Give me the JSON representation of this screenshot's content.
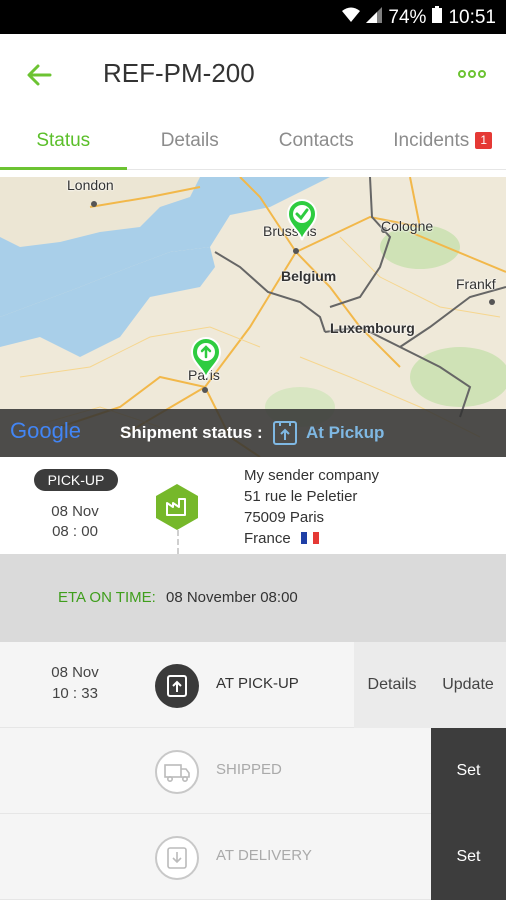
{
  "status_bar": {
    "battery": "74%",
    "time": "10:51"
  },
  "header": {
    "title": "REF-PM-200",
    "back_icon": "arrow-left-icon",
    "menu_icon": "more-dots-icon",
    "accent": "#6cc332"
  },
  "tabs": [
    {
      "label": "Status",
      "active": true
    },
    {
      "label": "Details",
      "active": false
    },
    {
      "label": "Contacts",
      "active": false
    },
    {
      "label": "Incidents",
      "active": false,
      "badge": "1"
    }
  ],
  "map": {
    "cities": [
      "London",
      "Brussels",
      "Belgium",
      "Cologne",
      "Frankf",
      "Luxembourg",
      "Paris"
    ],
    "google_logo": "Google",
    "shipment_status_label": "Shipment status :",
    "shipment_status_value": "At Pickup"
  },
  "pickup": {
    "badge": "PICK-UP",
    "date": "08 Nov",
    "time": "08 : 00",
    "address": [
      "My sender company",
      "51 rue le Peletier",
      "75009  Paris",
      "France"
    ],
    "flag": "france-flag"
  },
  "eta": {
    "label": "ETA ON TIME:",
    "value": "08 November 08:00"
  },
  "steps": [
    {
      "label": "AT PICK-UP",
      "date": "08 Nov",
      "time": "10 : 33",
      "details_label": "Details",
      "update_label": "Update"
    },
    {
      "label": "SHIPPED",
      "set_label": "Set"
    },
    {
      "label": "AT DELIVERY",
      "set_label": "Set"
    }
  ]
}
